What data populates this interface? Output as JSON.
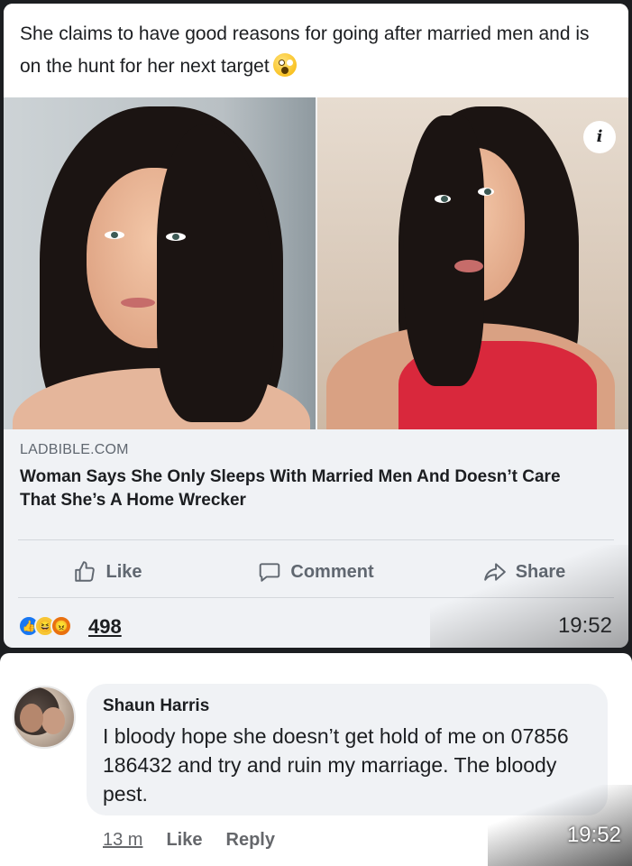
{
  "post": {
    "text": "She claims to have good reasons for going after married men and is on the hunt for her next target",
    "emoji": "shocked-face-emoji",
    "link": {
      "domain": "LADBIBLE.COM",
      "title": "Woman Says She Only Sleeps With Married Men And Doesn’t Care That She’s A Home Wrecker"
    },
    "info_label": "i",
    "actions": {
      "like": "Like",
      "comment": "Comment",
      "share": "Share"
    },
    "reaction_count": "498",
    "time": "19:52"
  },
  "comment": {
    "author": "Shaun Harris",
    "text": "I bloody hope she doesn’t get hold of me on 07856 186432 and try and ruin my marriage. The bloody pest.",
    "age": "13 m",
    "like_label": "Like",
    "reply_label": "Reply",
    "time": "19:52"
  },
  "colors": {
    "background": "#1c1e21",
    "card": "#f0f2f5",
    "text": "#1c1e21",
    "muted": "#606770",
    "like_blue": "#1877f2"
  }
}
